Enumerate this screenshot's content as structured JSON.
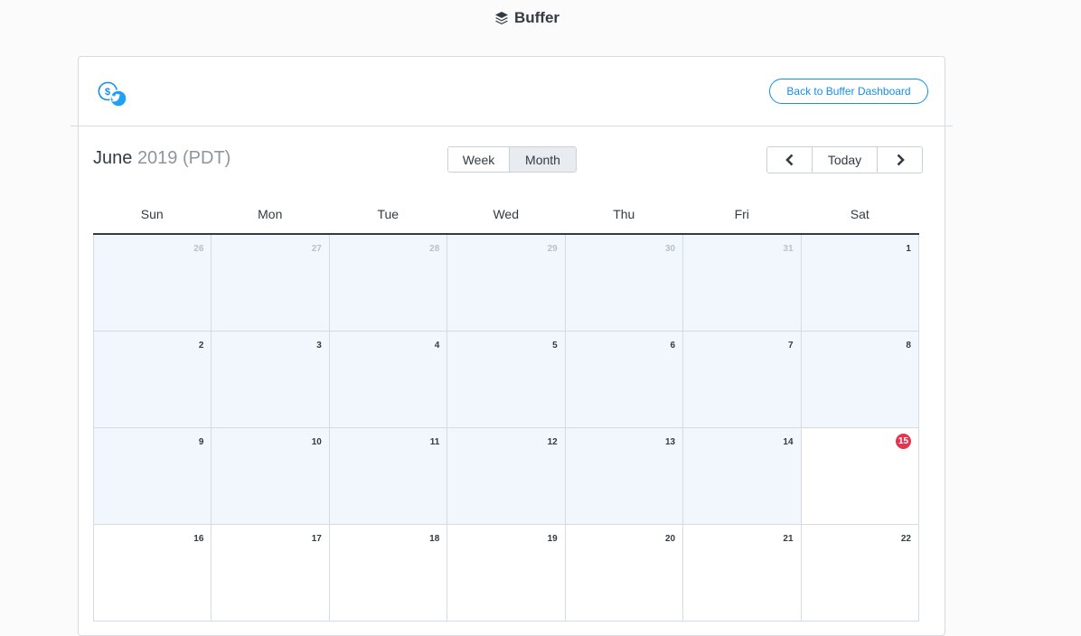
{
  "app": {
    "name": "Buffer",
    "logo_icon": "buffer-stack-icon"
  },
  "header": {
    "profile_icon": "twitter-profile-icon",
    "back_button_label": "Back to Buffer Dashboard"
  },
  "calendar": {
    "month": "June",
    "year": "2019",
    "timezone": "(PDT)",
    "views": [
      {
        "label": "Week",
        "active": false
      },
      {
        "label": "Month",
        "active": true
      }
    ],
    "nav": {
      "prev_icon": "chevron-left-icon",
      "today_label": "Today",
      "next_icon": "chevron-right-icon"
    },
    "weekdays": [
      "Sun",
      "Mon",
      "Tue",
      "Wed",
      "Thu",
      "Fri",
      "Sat"
    ],
    "weeks": [
      [
        {
          "day": "26",
          "other_month": true,
          "past": true
        },
        {
          "day": "27",
          "other_month": true,
          "past": true
        },
        {
          "day": "28",
          "other_month": true,
          "past": true
        },
        {
          "day": "29",
          "other_month": true,
          "past": true
        },
        {
          "day": "30",
          "other_month": true,
          "past": true
        },
        {
          "day": "31",
          "other_month": true,
          "past": true
        },
        {
          "day": "1",
          "other_month": false,
          "past": true
        }
      ],
      [
        {
          "day": "2",
          "other_month": false,
          "past": true
        },
        {
          "day": "3",
          "other_month": false,
          "past": true
        },
        {
          "day": "4",
          "other_month": false,
          "past": true
        },
        {
          "day": "5",
          "other_month": false,
          "past": true
        },
        {
          "day": "6",
          "other_month": false,
          "past": true
        },
        {
          "day": "7",
          "other_month": false,
          "past": true
        },
        {
          "day": "8",
          "other_month": false,
          "past": true
        }
      ],
      [
        {
          "day": "9",
          "other_month": false,
          "past": true
        },
        {
          "day": "10",
          "other_month": false,
          "past": true
        },
        {
          "day": "11",
          "other_month": false,
          "past": true
        },
        {
          "day": "12",
          "other_month": false,
          "past": true
        },
        {
          "day": "13",
          "other_month": false,
          "past": true
        },
        {
          "day": "14",
          "other_month": false,
          "past": true
        },
        {
          "day": "15",
          "other_month": false,
          "past": false,
          "today": true
        }
      ],
      [
        {
          "day": "16",
          "other_month": false,
          "past": false
        },
        {
          "day": "17",
          "other_month": false,
          "past": false
        },
        {
          "day": "18",
          "other_month": false,
          "past": false
        },
        {
          "day": "19",
          "other_month": false,
          "past": false
        },
        {
          "day": "20",
          "other_month": false,
          "past": false
        },
        {
          "day": "21",
          "other_month": false,
          "past": false
        },
        {
          "day": "22",
          "other_month": false,
          "past": false
        }
      ]
    ]
  },
  "colors": {
    "accent": "#168eea",
    "today_badge": "#e0364f",
    "past_day_bg": "#f1f7fd",
    "text": "#323b43"
  }
}
